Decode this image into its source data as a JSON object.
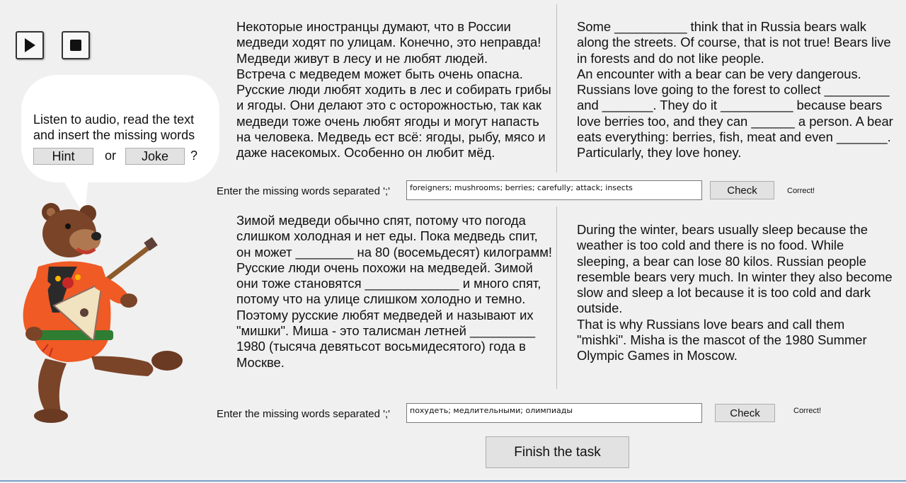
{
  "controls": {
    "play_icon": "play-icon",
    "stop_icon": "stop-icon"
  },
  "bubble": {
    "instruction": "Listen to audio, read the text and insert the missing words",
    "hint_label": "Hint",
    "or_label": "or",
    "joke_label": "Joke",
    "question_mark": "?"
  },
  "section1": {
    "russian": "Некоторые иностранцы думают, что в России медведи ходят по улицам. Конечно, это неправда! Медведи живут в лесу и не любят людей.\nВстреча с медведем может быть очень опасна. Русские люди любят ходить в лес и собирать грибы и ягоды. Они делают это с осторожностью, так как медведи тоже очень любят ягоды и могут напасть на человека. Медведь ест всё: ягоды, рыбу, мясо и даже насекомых. Особенно он любит мёд.",
    "english": "Some __________ think that in Russia bears walk along the streets. Of course, that is not true! Bears live in forests and do not like people.\nAn encounter with a bear can be very dangerous. Russians love going to the forest to collect _________ and _______. They do it __________ because bears love berries too, and they can ______ a person. A bear eats everything: berries, fish, meat and even _______. Particularly, they love honey.",
    "answer_label": "Enter the missing words separated ';'",
    "answer_value": "foreigners; mushrooms; berries; carefully; attack; insects",
    "check_label": "Check",
    "status": "Correct!"
  },
  "section2": {
    "russian": "Зимой медведи обычно спят, потому что погода слишком холодная и нет еды. Пока медведь спит, он может ________ на 80 (восемьдесят) килограмм! Русские люди очень похожи на медведей. Зимой они тоже становятся _____________ и много спят, потому что на улице слишком холодно и темно.\nПоэтому русские любят медведей и называют их \"мишки\". Миша - это талисман летней _________ 1980 (тысяча девятьсот восьмидесятого) года в Москве.",
    "english": "During the winter, bears usually sleep because the weather is too cold and there is no food. While sleeping, a bear can lose 80 kilos. Russian people resemble bears very much. In winter they also become slow and sleep a lot because it is too cold and dark outside.\nThat is why Russians love bears and call them \"mishki\". Misha is the mascot of the 1980 Summer Olympic Games in Moscow.",
    "answer_label": "Enter the missing words separated ';'",
    "answer_value": "похудеть; медлительными; олимпиады",
    "check_label": "Check",
    "status": "Correct!"
  },
  "finish_label": "Finish the task",
  "colors": {
    "background": "#f0f0f0",
    "button": "#e2e2e2",
    "bear_shirt": "#f05a24",
    "bear_fur": "#6b3a22"
  }
}
